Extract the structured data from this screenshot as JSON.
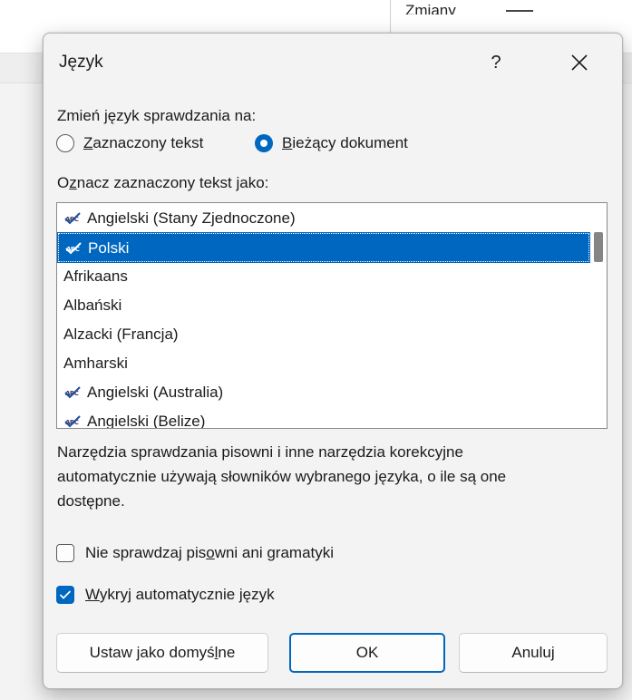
{
  "background": {
    "fragment_text": "Zmiany"
  },
  "dialog": {
    "title": "Język",
    "help_label": "?",
    "change_language_label": "Zmień język sprawdzania na:",
    "radio_options": [
      {
        "label_u": "Z",
        "label_rest": "aznaczony tekst",
        "selected": false
      },
      {
        "label_u": "B",
        "label_rest": "ieżący dokument",
        "selected": true
      }
    ],
    "mark_text_label_pre": "O",
    "mark_text_label_u": "z",
    "mark_text_label_post": "nacz zaznaczony tekst jako:",
    "languages": [
      {
        "name": "Angielski (Stany Zjednoczone)",
        "spell_icon": true,
        "selected": false
      },
      {
        "name": "Polski",
        "spell_icon": true,
        "selected": true
      },
      {
        "name": "Afrikaans",
        "spell_icon": false,
        "selected": false
      },
      {
        "name": "Albański",
        "spell_icon": false,
        "selected": false
      },
      {
        "name": "Alzacki (Francja)",
        "spell_icon": false,
        "selected": false
      },
      {
        "name": "Amharski",
        "spell_icon": false,
        "selected": false
      },
      {
        "name": "Angielski (Australia)",
        "spell_icon": true,
        "selected": false
      },
      {
        "name": "Angielski (Belize)",
        "spell_icon": true,
        "selected": false
      }
    ],
    "spell_icon_text": "ABC",
    "description_lines": [
      "Narzędzia sprawdzania pisowni i inne narzędzia korekcyjne",
      "automatycznie używają słowników wybranego języka, o ile są one",
      "dostępne."
    ],
    "checkboxes": [
      {
        "label_pre": "Nie sprawdzaj pis",
        "label_u": "o",
        "label_post": "wni ani gramatyki",
        "checked": false
      },
      {
        "label_pre": "",
        "label_u": "W",
        "label_post": "ykryj automatycznie język",
        "checked": true
      }
    ],
    "buttons": {
      "default_pre": "Ustaw jako domyś",
      "default_u": "l",
      "default_post": "ne",
      "ok": "OK",
      "cancel": "Anuluj"
    },
    "colors": {
      "accent": "#0067c0"
    }
  }
}
